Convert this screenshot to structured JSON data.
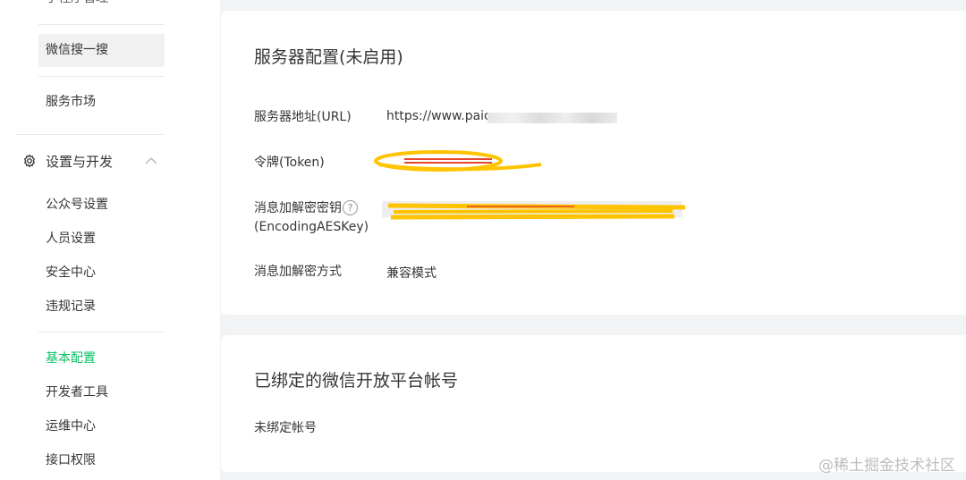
{
  "sidebar": {
    "top_partial": "小程序管理",
    "items_top": [
      {
        "label": "微信搜一搜"
      },
      {
        "label": "服务市场"
      }
    ],
    "group": {
      "label": "设置与开发"
    },
    "group_items": [
      {
        "label": "公众号设置"
      },
      {
        "label": "人员设置"
      },
      {
        "label": "安全中心"
      },
      {
        "label": "违规记录"
      }
    ],
    "dev_items": [
      {
        "label": "基本配置",
        "active": true
      },
      {
        "label": "开发者工具"
      },
      {
        "label": "运维中心"
      },
      {
        "label": "接口权限"
      }
    ]
  },
  "server_config": {
    "title": "服务器配置(未启用)",
    "url_label": "服务器地址(URL)",
    "url_value": "https://www.paic",
    "token_label": "令牌(Token)",
    "aeskey_label": "消息加解密密钥",
    "aeskey_label_2": "(EncodingAESKey)",
    "help_symbol": "?",
    "mode_label": "消息加解密方式",
    "mode_value": "兼容模式"
  },
  "bound_accounts": {
    "title": "已绑定的微信开放平台帐号",
    "empty_text": "未绑定帐号"
  },
  "watermark": "@稀土掘金技术社区",
  "colors": {
    "accent": "#07c160",
    "background": "#f2f3f5",
    "scribble": "#ffc300",
    "scribble_red": "#e8462a"
  },
  "icons": {
    "group": "gear-icon",
    "group_toggle": "chevron-up-icon",
    "help": "question-circle-icon"
  }
}
